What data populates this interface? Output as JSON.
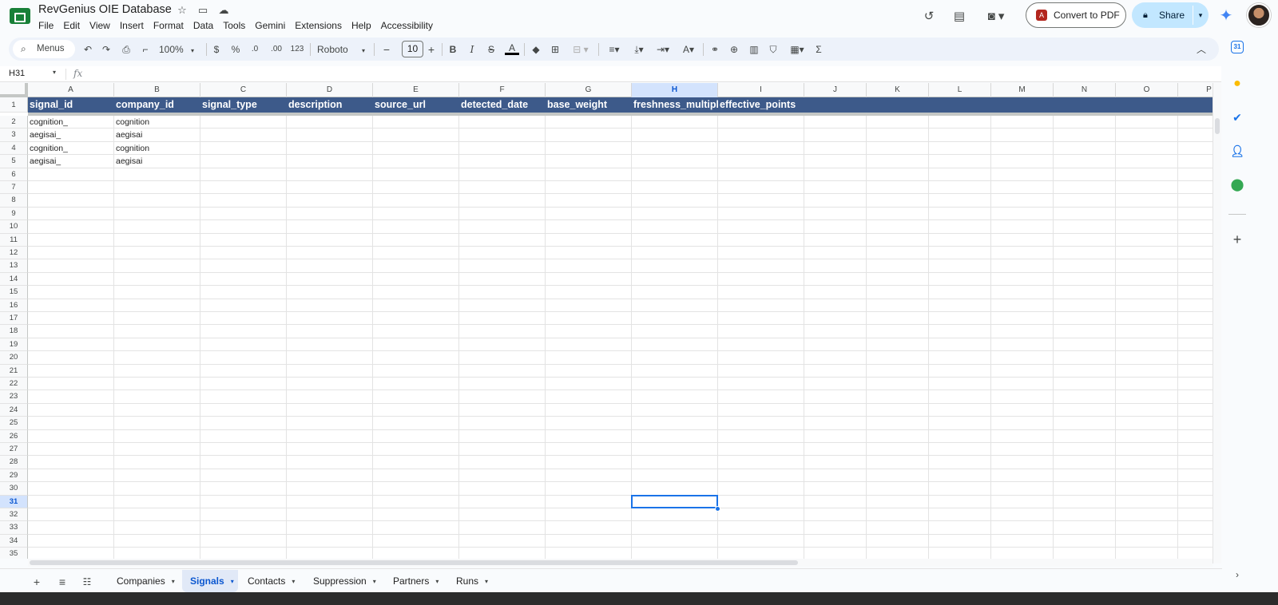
{
  "app": {
    "title": "RevGenius OIE Database",
    "menu": [
      "File",
      "Edit",
      "View",
      "Insert",
      "Format",
      "Data",
      "Tools",
      "Gemini",
      "Extensions",
      "Help",
      "Accessibility"
    ],
    "convert_pdf_label": "Convert to PDF",
    "share_label": "Share"
  },
  "toolbar": {
    "menus_label": "Menus",
    "zoom": "100%",
    "currency": "$",
    "percent": "%",
    "dec_decrease": ".0",
    "dec_increase": ".00",
    "number_format": "123",
    "font": "Roboto",
    "font_size": "10",
    "minus": "−",
    "plus": "+",
    "bold": "B",
    "italic": "I",
    "sigma": "Σ"
  },
  "formula_bar": {
    "cell_ref": "H31",
    "fx": "fx"
  },
  "grid": {
    "columns": [
      "A",
      "B",
      "C",
      "D",
      "E",
      "F",
      "G",
      "H",
      "I",
      "J",
      "K",
      "L",
      "M",
      "N",
      "O",
      "P"
    ],
    "active_column": "H",
    "active_row": 31,
    "header_row": [
      "signal_id",
      "company_id",
      "signal_type",
      "description",
      "source_url",
      "detected_date",
      "base_weight",
      "freshness_multipl",
      "effective_points"
    ],
    "rows": [
      [
        "cognition_",
        "cognition"
      ],
      [
        "aegisai_",
        "aegisai"
      ],
      [
        "cognition_",
        "cognition"
      ],
      [
        "aegisai_",
        "aegisai"
      ]
    ],
    "row_count": 35
  },
  "sheets": {
    "tabs": [
      "Companies",
      "Signals",
      "Contacts",
      "Suppression",
      "Partners",
      "Runs"
    ],
    "active": "Signals"
  },
  "colors": {
    "header_fill": "#3d5a8a",
    "accent": "#1a73e8",
    "share_bg": "#c2e7ff"
  }
}
